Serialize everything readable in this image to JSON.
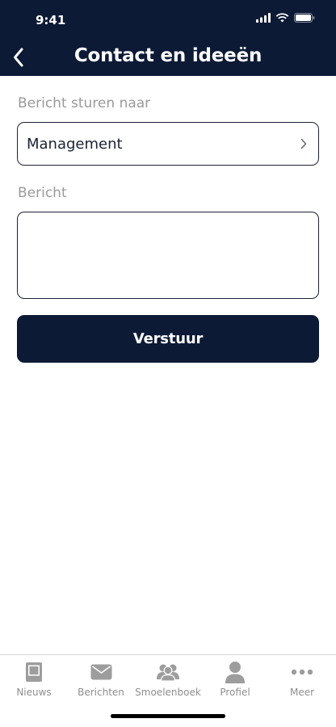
{
  "status_bar": {
    "time": "9:41"
  },
  "header": {
    "title": "Contact en ideeën",
    "back_icon": "chevron-left-icon"
  },
  "form": {
    "recipient_label": "Bericht sturen naar",
    "recipient_value": "Management",
    "message_label": "Bericht",
    "message_value": "",
    "submit_label": "Verstuur"
  },
  "tab_bar": {
    "items": [
      {
        "label": "Nieuws",
        "icon": "newspaper-icon"
      },
      {
        "label": "Berichten",
        "icon": "envelope-icon"
      },
      {
        "label": "Smoelenboek",
        "icon": "people-icon"
      },
      {
        "label": "Profiel",
        "icon": "person-icon"
      },
      {
        "label": "Meer",
        "icon": "more-icon"
      }
    ]
  },
  "colors": {
    "header_bg": "#0c1a36",
    "button_bg": "#0c1a36",
    "label_gray": "#9a9a9a",
    "tab_gray": "#8e8e8e"
  }
}
